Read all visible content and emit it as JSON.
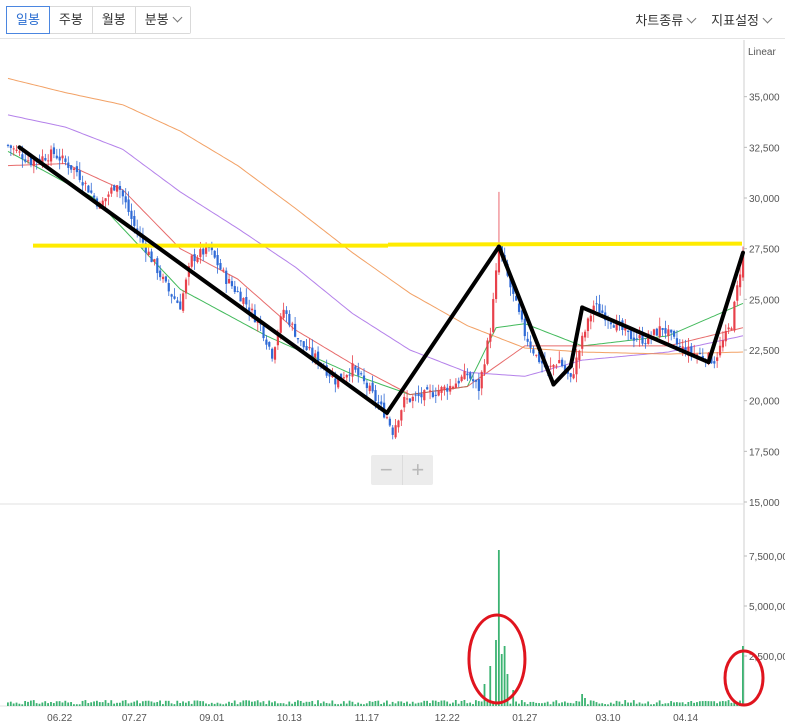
{
  "toolbar": {
    "period_tabs": [
      {
        "label": "일봉",
        "active": true
      },
      {
        "label": "주봉",
        "active": false
      },
      {
        "label": "월봉",
        "active": false
      },
      {
        "label": "분봉",
        "active": false
      }
    ],
    "chart_type_label": "차트종류",
    "indicator_label": "지표설정"
  },
  "zoom": {
    "zoom_out_symbol": "−",
    "zoom_in_symbol": "+"
  },
  "colors": {
    "up_candle": "#e8414b",
    "down_candle": "#2f6ad6",
    "ma_short": "#2fb34a",
    "ma_20": "#e35151",
    "ma_60": "#a76be6",
    "ma_120": "#f0914a",
    "volume": "#3cb372",
    "trend_line": "#000000",
    "resistance_line": "#ffeb00",
    "annotation_circle": "#e0141e"
  },
  "chart_data": {
    "type": "candlestick",
    "scale_label": "Linear",
    "price_axis": {
      "ylim": [
        15000,
        37500
      ],
      "ticks": [
        "15,000",
        "17,500",
        "20,000",
        "22,500",
        "25,000",
        "27,500",
        "30,000",
        "32,500",
        "35,000"
      ],
      "tick_values": [
        15000,
        17500,
        20000,
        22500,
        25000,
        27500,
        30000,
        32500,
        35000
      ]
    },
    "volume_axis": {
      "ylim": [
        0,
        10000000
      ],
      "ticks": [
        "2,500,00",
        "5,000,00",
        "7,500,00"
      ],
      "tick_values": [
        2500000,
        5000000,
        7500000
      ]
    },
    "x_labels": [
      "06.22",
      "07.27",
      "09.01",
      "10.13",
      "11.17",
      "12.22",
      "01.27",
      "03.10",
      "04.14"
    ],
    "price_path": [
      [
        0,
        32600
      ],
      [
        8,
        31800
      ],
      [
        16,
        32200
      ],
      [
        24,
        31300
      ],
      [
        32,
        29600
      ],
      [
        38,
        30800
      ],
      [
        44,
        28600
      ],
      [
        50,
        27000
      ],
      [
        56,
        25400
      ],
      [
        60,
        24700
      ],
      [
        64,
        27000
      ],
      [
        70,
        27500
      ],
      [
        76,
        26000
      ],
      [
        82,
        25000
      ],
      [
        88,
        23700
      ],
      [
        92,
        22300
      ],
      [
        96,
        24500
      ],
      [
        102,
        22800
      ],
      [
        108,
        22000
      ],
      [
        114,
        21000
      ],
      [
        120,
        21600
      ],
      [
        126,
        20500
      ],
      [
        132,
        19200
      ],
      [
        134,
        18500
      ],
      [
        138,
        20000
      ],
      [
        146,
        20300
      ],
      [
        154,
        20700
      ],
      [
        160,
        21300
      ],
      [
        164,
        20600
      ],
      [
        168,
        23500
      ],
      [
        171,
        27600
      ],
      [
        175,
        25600
      ],
      [
        180,
        23300
      ],
      [
        184,
        22200
      ],
      [
        188,
        21500
      ],
      [
        192,
        22000
      ],
      [
        196,
        21000
      ],
      [
        200,
        23000
      ],
      [
        204,
        24700
      ],
      [
        210,
        24000
      ],
      [
        216,
        23200
      ],
      [
        222,
        23000
      ],
      [
        228,
        23600
      ],
      [
        234,
        22600
      ],
      [
        240,
        22300
      ],
      [
        246,
        22000
      ],
      [
        252,
        23800
      ],
      [
        256,
        27300
      ]
    ],
    "highlighted_candle": {
      "index": 171,
      "high": 30300
    },
    "moving_averages": [
      {
        "name": "MA5",
        "values": [
          [
            0,
            32300
          ],
          [
            30,
            30000
          ],
          [
            60,
            25500
          ],
          [
            90,
            23200
          ],
          [
            120,
            21300
          ],
          [
            140,
            20300
          ],
          [
            160,
            20700
          ],
          [
            170,
            23600
          ],
          [
            180,
            23800
          ],
          [
            200,
            22700
          ],
          [
            230,
            23200
          ],
          [
            256,
            24800
          ]
        ]
      },
      {
        "name": "MA20",
        "values": [
          [
            0,
            31600
          ],
          [
            20,
            31700
          ],
          [
            40,
            30400
          ],
          [
            60,
            27500
          ],
          [
            80,
            26000
          ],
          [
            100,
            23500
          ],
          [
            120,
            21800
          ],
          [
            140,
            20300
          ],
          [
            160,
            20700
          ],
          [
            180,
            22700
          ],
          [
            200,
            22700
          ],
          [
            230,
            22700
          ],
          [
            256,
            23600
          ]
        ]
      },
      {
        "name": "MA60",
        "values": [
          [
            0,
            34100
          ],
          [
            20,
            33500
          ],
          [
            40,
            32400
          ],
          [
            60,
            30300
          ],
          [
            80,
            28500
          ],
          [
            100,
            26600
          ],
          [
            120,
            24300
          ],
          [
            140,
            22500
          ],
          [
            160,
            21400
          ],
          [
            180,
            21200
          ],
          [
            200,
            22000
          ],
          [
            230,
            22400
          ],
          [
            256,
            23200
          ]
        ]
      },
      {
        "name": "MA120",
        "values": [
          [
            0,
            35900
          ],
          [
            20,
            35200
          ],
          [
            40,
            34600
          ],
          [
            60,
            33300
          ],
          [
            80,
            31600
          ],
          [
            100,
            29500
          ],
          [
            120,
            27300
          ],
          [
            140,
            25300
          ],
          [
            160,
            23700
          ],
          [
            180,
            22600
          ],
          [
            200,
            22400
          ],
          [
            230,
            22300
          ],
          [
            256,
            22400
          ]
        ]
      }
    ],
    "trend_lines": [
      [
        [
          4,
          32500
        ],
        [
          132,
          19400
        ]
      ],
      [
        [
          132,
          19400
        ],
        [
          171,
          27600
        ]
      ],
      [
        [
          171,
          27600
        ],
        [
          190,
          20800
        ]
      ],
      [
        [
          190,
          20800
        ],
        [
          196,
          21700
        ]
      ],
      [
        [
          196,
          21700
        ],
        [
          200,
          24600
        ]
      ],
      [
        [
          200,
          24600
        ],
        [
          244,
          21900
        ]
      ],
      [
        [
          244,
          21900
        ],
        [
          256,
          27300
        ]
      ]
    ],
    "resistance_level": 27700,
    "volume_spikes": [
      [
        166,
        1100000
      ],
      [
        168,
        2000000
      ],
      [
        170,
        3300000
      ],
      [
        171,
        7800000
      ],
      [
        172,
        2600000
      ],
      [
        173,
        3000000
      ],
      [
        174,
        1600000
      ],
      [
        176,
        800000
      ],
      [
        200,
        600000
      ],
      [
        201,
        400000
      ],
      [
        256,
        3000000
      ]
    ],
    "volume_highlights": [
      {
        "index": 171,
        "label": ""
      },
      {
        "index": 256,
        "label": ""
      }
    ]
  }
}
